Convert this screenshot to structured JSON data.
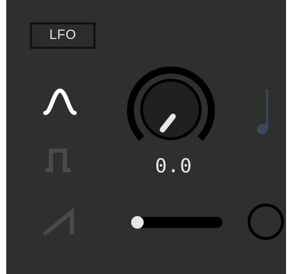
{
  "device": {
    "label": "LFO"
  },
  "waveforms": {
    "items": [
      {
        "name": "sine",
        "icon": "sine-wave-icon",
        "selected": true
      },
      {
        "name": "square",
        "icon": "square-wave-icon",
        "selected": false
      },
      {
        "name": "saw",
        "icon": "sawtooth-wave-icon",
        "selected": false
      }
    ]
  },
  "rate_knob": {
    "value": "0.0"
  },
  "sync": {
    "icon": "note-icon"
  },
  "amount_slider": {
    "level": 0.0
  },
  "toggle": {
    "icon": "circle-toggle-icon",
    "on": false
  },
  "colors": {
    "panel": "#2f2f2f",
    "active": "#ffffff",
    "inactive": "#4a4a4a",
    "knob_ring": "#000000",
    "note": "#3a4a5e"
  }
}
